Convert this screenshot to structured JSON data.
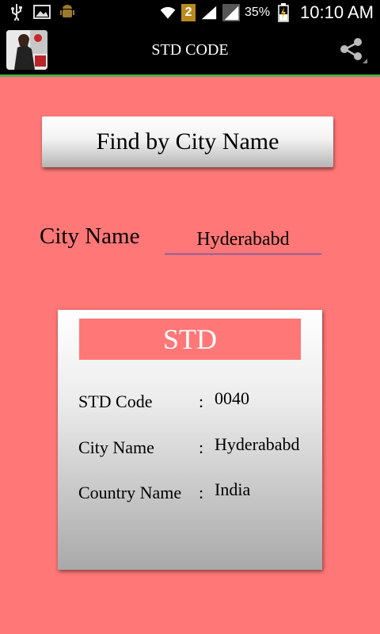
{
  "status_bar": {
    "battery": "35%",
    "notification_badge": "2",
    "time": "10:10 AM",
    "icons": [
      "usb-icon",
      "image-icon",
      "android-icon",
      "wifi-icon",
      "signal-icon",
      "battery-charging-icon"
    ]
  },
  "app_bar": {
    "title": "STD CODE",
    "share_icon": "share-icon",
    "accent_color": "#4CAF50"
  },
  "main": {
    "background": "#FF7777",
    "find_button_label": "Find by City Name",
    "city_label": "City Name",
    "city_input_value": "Hyderababd"
  },
  "result_card": {
    "header": "STD",
    "rows": [
      {
        "label": "STD Code",
        "separator": ":",
        "value": "0040"
      },
      {
        "label": "City Name",
        "separator": ":",
        "value": "Hyderababd"
      },
      {
        "label": "Country Name",
        "separator": ":",
        "value": "India"
      }
    ]
  }
}
